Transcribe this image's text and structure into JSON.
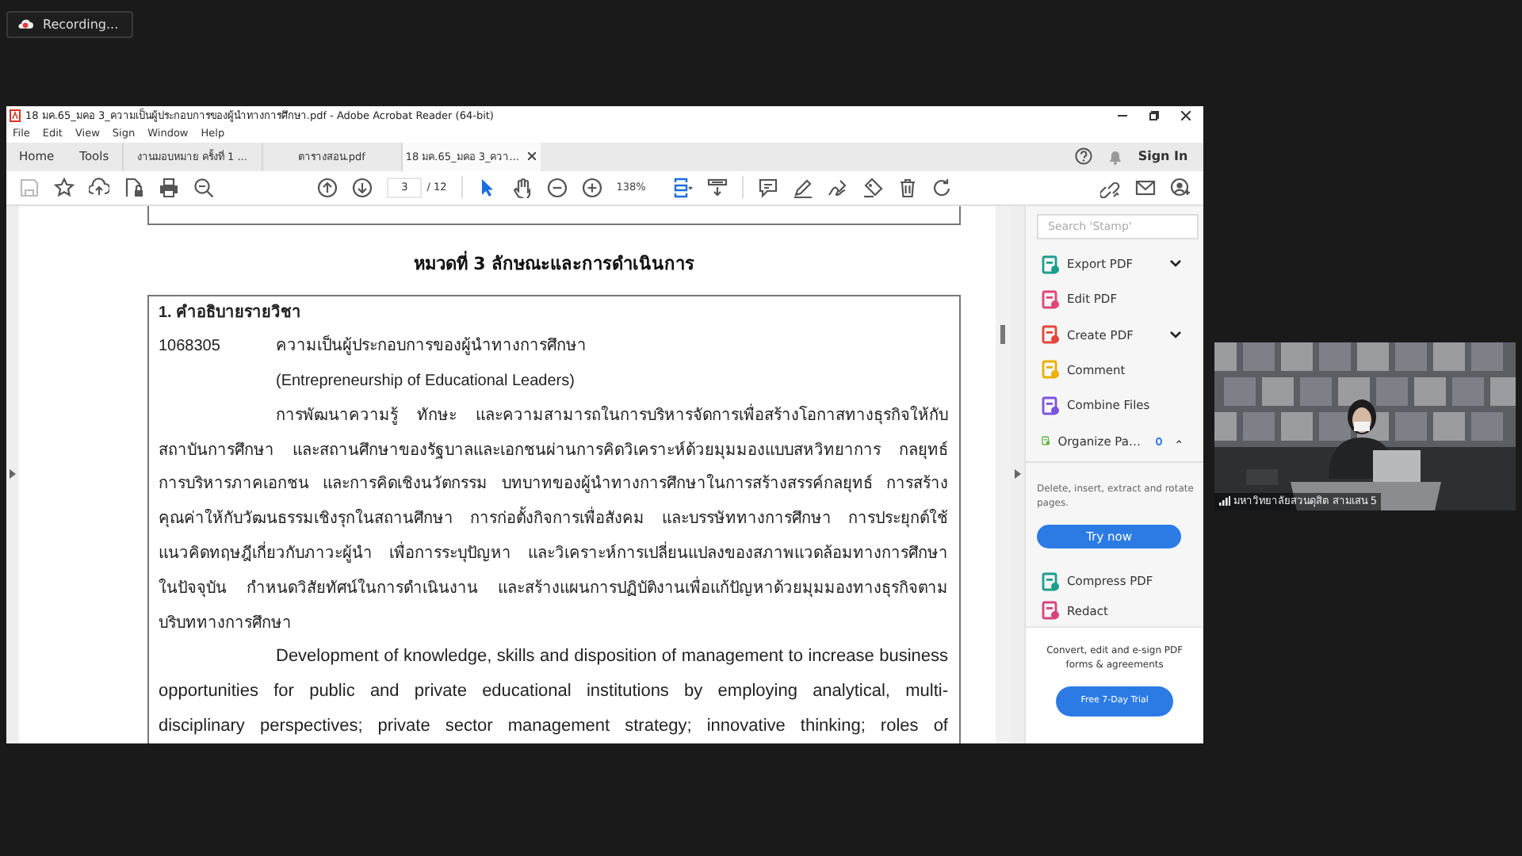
{
  "recording": {
    "label": "Recording..."
  },
  "window": {
    "title": "18 มค.65_มคอ 3_ความเป็นผู้ประกอบการของผู้นำทางการศึกษา.pdf - Adobe Acrobat Reader (64-bit)"
  },
  "menu": [
    "File",
    "Edit",
    "View",
    "Sign",
    "Window",
    "Help"
  ],
  "nav": [
    "Home",
    "Tools"
  ],
  "doc_tabs": [
    {
      "label": "งานมอบหมาย ครั้งที่ 1 ...",
      "selected": false
    },
    {
      "label": "ตารางสอน.pdf",
      "selected": false
    },
    {
      "label": "18 มค.65_มคอ 3_ควา...",
      "selected": true
    }
  ],
  "sign_in": "Sign In",
  "toolbar": {
    "page": "3",
    "page_total": "/ 12",
    "zoom": "138%"
  },
  "document": {
    "heading": "หมวดที่ 3 ลักษณะและการดำเนินการ",
    "section_title": "1. คำอธิบายรายวิชา",
    "course_code": "1068305",
    "course_name_th": "ความเป็นผู้ประกอบการของผู้นำทางการศึกษา",
    "course_name_en": "(Entrepreneurship of Educational Leaders)",
    "paragraphs": [
      {
        "lines": [
          "การพัฒนาความรู้ ทักษะ และความสามารถในการบริหารจัดการเพื่อสร้างโอกาสทางธุรกิจให้กับ",
          "สถาบันการศึกษา และสถานศึกษาของรัฐบาลและเอกชนผ่านการคิดวิเคราะห์ด้วยมุมมองแบบสหวิทยาการ กลยุทธ์",
          "การบริหารภาคเอกชน และการคิดเชิงนวัตกรรม บทบาทของผู้นำทางการศึกษาในการสร้างสรรค์กลยุทธ์ การสร้าง",
          "คุณค่าให้กับวัฒนธรรมเชิงรุกในสถานศึกษา การก่อตั้งกิจการเพื่อสังคม และบรรษัททางการศึกษา การประยุกต์ใช้",
          "แนวคิดทฤษฎีเกี่ยวกับภาวะผู้นำ เพื่อการระบุปัญหา และวิเคราะห์การเปลี่ยนแปลงของสภาพแวดล้อมทางการศึกษา",
          "ในปัจจุบัน กำหนดวิสัยทัศน์ในการดำเนินงาน และสร้างแผนการปฏิบัติงานเพื่อแก้ปัญหาด้วยมุมมองทางธุรกิจตาม",
          "บริบททางการศึกษา"
        ]
      },
      {
        "lines": [
          "Development of knowledge, skills and disposition of management to increase business",
          "opportunities for public and private educational institutions by employing analytical, multi-",
          "disciplinary perspectives; private sector management strategy; innovative thinking; roles of"
        ]
      }
    ]
  },
  "tools_panel": {
    "search_placeholder": "Search 'Stamp'",
    "items": [
      {
        "label": "Export PDF",
        "color": "#1f9e8c",
        "expanded": false
      },
      {
        "label": "Edit PDF",
        "color": "#e0457b"
      },
      {
        "label": "Create PDF",
        "color": "#e5463d",
        "expanded": false
      },
      {
        "label": "Comment",
        "color": "#e9b100"
      },
      {
        "label": "Combine Files",
        "color": "#7b55e0"
      },
      {
        "label": "Organize Pa…",
        "color": "#5eb445",
        "expanded": true,
        "new_dot": true
      }
    ],
    "description": "Delete, insert, extract and rotate pages.",
    "try_button": "Try now",
    "more_items": [
      {
        "label": "Compress PDF",
        "color": "#1f9e8c"
      },
      {
        "label": "Redact",
        "color": "#d6457e"
      }
    ],
    "footer_text": "Convert, edit and e-sign PDF forms & agreements",
    "trial_button": "Free 7-Day Trial"
  },
  "video": {
    "participant": "มหาวิทยาลัยสวนดุสิต สามเสน 5"
  }
}
